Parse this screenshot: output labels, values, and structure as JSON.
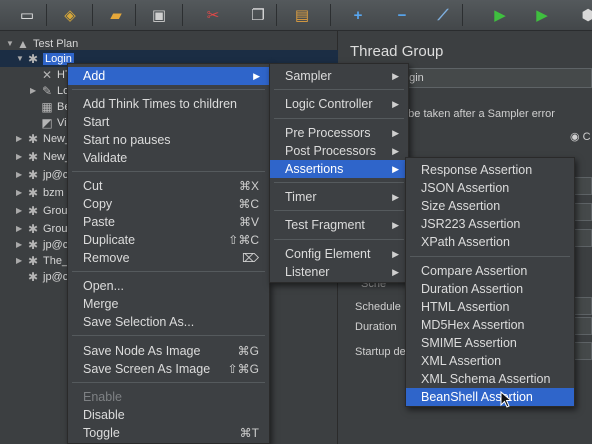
{
  "toolbar": {
    "buttons": [
      {
        "icon": "new-file-icon",
        "glyph": "▭",
        "color": "#e8e8e8"
      },
      {
        "icon": "templates-icon",
        "glyph": "◈",
        "color": "#d7a83a"
      },
      {
        "icon": "open-icon",
        "glyph": "▰",
        "color": "#e6a83a"
      },
      {
        "icon": "save-icon",
        "glyph": "▣",
        "color": "#cfcfcf"
      },
      {
        "icon": "cut-icon",
        "glyph": "✂",
        "color": "#e04848"
      },
      {
        "icon": "copy-icon",
        "glyph": "❐",
        "color": "#dcdcdc"
      },
      {
        "icon": "paste-icon",
        "glyph": "▤",
        "color": "#e0a040"
      },
      {
        "icon": "expand-icon",
        "glyph": "+",
        "color": "#58a6f0"
      },
      {
        "icon": "collapse-icon",
        "glyph": "−",
        "color": "#58a6f0"
      },
      {
        "icon": "toggle-icon",
        "glyph": "⟋",
        "color": "#7fb0e0"
      },
      {
        "icon": "start-icon",
        "glyph": "▶",
        "color": "#3fbf3f"
      },
      {
        "icon": "start-no-pauses-icon",
        "glyph": "▶",
        "color": "#3fbf3f"
      },
      {
        "icon": "stop-icon",
        "glyph": "⬢",
        "color": "#d8d8d8"
      }
    ]
  },
  "tree": {
    "rows": [
      {
        "label": "Test Plan",
        "icon": "test-plan-icon",
        "glyph": "▲",
        "arrow": "▼",
        "level": 0
      },
      {
        "label": "Login",
        "icon": "thread-group-gear-icon",
        "glyph": "✱",
        "arrow": "▼",
        "level": 1,
        "selected": true
      },
      {
        "label": "HT",
        "icon": "http-sampler-icon",
        "glyph": "✕",
        "arrow": "",
        "level": 2
      },
      {
        "label": "Log",
        "icon": "edit-icon",
        "glyph": "✎",
        "arrow": "▶",
        "level": 2
      },
      {
        "label": "Bea",
        "icon": "beanshell-icon",
        "glyph": "▦",
        "arrow": "",
        "level": 2
      },
      {
        "label": "Vie",
        "icon": "results-tree-icon",
        "glyph": "◩",
        "arrow": "",
        "level": 2
      },
      {
        "label": "New_",
        "icon": "thread-group-gear-icon",
        "glyph": "✱",
        "arrow": "▶",
        "level": 1
      },
      {
        "label": "New_",
        "icon": "thread-group-gear-icon",
        "glyph": "✱",
        "arrow": "▶",
        "level": 1
      },
      {
        "label": "jp@c",
        "icon": "thread-group-gear-icon",
        "glyph": "✱",
        "arrow": "▶",
        "level": 1
      },
      {
        "label": "bzm",
        "icon": "thread-group-gear-icon",
        "glyph": "✱",
        "arrow": "▶",
        "level": 1
      },
      {
        "label": "Grou",
        "icon": "thread-group-gear-icon",
        "glyph": "✱",
        "arrow": "▶",
        "level": 1
      },
      {
        "label": "Grou",
        "icon": "thread-group-gear-icon",
        "glyph": "✱",
        "arrow": "▶",
        "level": 1
      },
      {
        "label": "jp@c",
        "icon": "thread-group-gear-icon",
        "glyph": "✱",
        "arrow": "▶",
        "level": 1
      },
      {
        "label": "The_",
        "icon": "thread-group-gear-icon",
        "glyph": "✱",
        "arrow": "▶",
        "level": 1
      },
      {
        "label": "jp@c",
        "icon": "thread-group-gear-icon",
        "glyph": "✱",
        "arrow": "",
        "level": 1
      }
    ]
  },
  "panel": {
    "title": "Thread Group",
    "name_value": "ogin",
    "error_label": "o be taken after a Sampler error",
    "radio_glyph": "◉",
    "radio_label": "C",
    "schedule_label": "Schedule",
    "duration_label": "Duration",
    "startup_label": "Startup de",
    "schedule_partial": "Sche"
  },
  "context_menu": {
    "items": [
      {
        "label": "Add",
        "shortcut": "",
        "submenu": true,
        "highlighted": true
      },
      {
        "label": "Add Think Times to children",
        "shortcut": ""
      },
      {
        "label": "Start",
        "shortcut": ""
      },
      {
        "label": "Start no pauses",
        "shortcut": ""
      },
      {
        "label": "Validate",
        "shortcut": ""
      },
      {
        "label": "Cut",
        "shortcut": "⌘X"
      },
      {
        "label": "Copy",
        "shortcut": "⌘C"
      },
      {
        "label": "Paste",
        "shortcut": "⌘V"
      },
      {
        "label": "Duplicate",
        "shortcut": "⇧⌘C"
      },
      {
        "label": "Remove",
        "shortcut": "⌦"
      },
      {
        "label": "Open...",
        "shortcut": ""
      },
      {
        "label": "Merge",
        "shortcut": ""
      },
      {
        "label": "Save Selection As...",
        "shortcut": ""
      },
      {
        "label": "Save Node As Image",
        "shortcut": "⌘G"
      },
      {
        "label": "Save Screen As Image",
        "shortcut": "⇧⌘G"
      },
      {
        "label": "Enable",
        "shortcut": "",
        "disabled": true
      },
      {
        "label": "Disable",
        "shortcut": ""
      },
      {
        "label": "Toggle",
        "shortcut": "⌘T"
      }
    ]
  },
  "add_menu": {
    "items": [
      {
        "label": "Sampler",
        "submenu": true
      },
      {
        "label": "Logic Controller",
        "submenu": true
      },
      {
        "label": "Pre Processors",
        "submenu": true
      },
      {
        "label": "Post Processors",
        "submenu": true
      },
      {
        "label": "Assertions",
        "submenu": true,
        "highlighted": true
      },
      {
        "label": "Timer",
        "submenu": true
      },
      {
        "label": "Test Fragment",
        "submenu": true
      },
      {
        "label": "Config Element",
        "submenu": true
      },
      {
        "label": "Listener",
        "submenu": true
      }
    ],
    "submenu_glyph": "▶"
  },
  "assertions_menu": {
    "items": [
      {
        "label": "Response Assertion"
      },
      {
        "label": "JSON Assertion"
      },
      {
        "label": "Size Assertion"
      },
      {
        "label": "JSR223 Assertion"
      },
      {
        "label": "XPath Assertion"
      },
      {
        "label": "Compare Assertion"
      },
      {
        "label": "Duration Assertion"
      },
      {
        "label": "HTML Assertion"
      },
      {
        "label": "MD5Hex Assertion"
      },
      {
        "label": "SMIME Assertion"
      },
      {
        "label": "XML Assertion"
      },
      {
        "label": "XML Schema Assertion"
      },
      {
        "label": "BeanShell Assertion",
        "highlighted": true
      }
    ]
  },
  "colors": {
    "highlight": "#2f65ca",
    "menu_bg": "#3d4043",
    "panel_bg": "#3c3f41"
  }
}
